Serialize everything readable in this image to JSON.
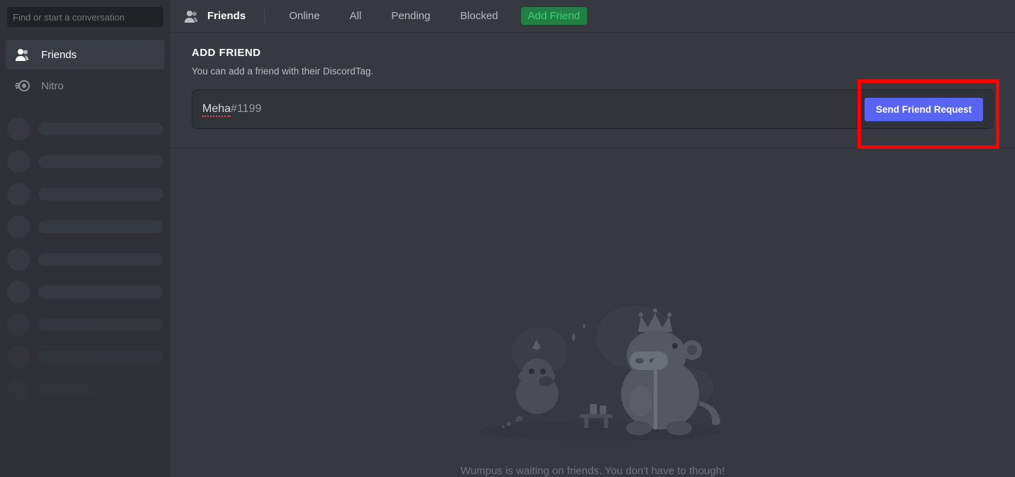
{
  "sidebar": {
    "search_placeholder": "Find or start a conversation",
    "friends_label": "Friends",
    "nitro_label": "Nitro"
  },
  "topbar": {
    "title": "Friends",
    "tabs": {
      "online": "Online",
      "all": "All",
      "pending": "Pending",
      "blocked": "Blocked",
      "add_friend": "Add Friend"
    }
  },
  "add_friend": {
    "heading": "ADD FRIEND",
    "subtext": "You can add a friend with their DiscordTag.",
    "input_name": "Meha",
    "input_tag": "#1199",
    "send_button": "Send Friend Request"
  },
  "empty": {
    "message": "Wumpus is waiting on friends. You don't have to though!"
  }
}
